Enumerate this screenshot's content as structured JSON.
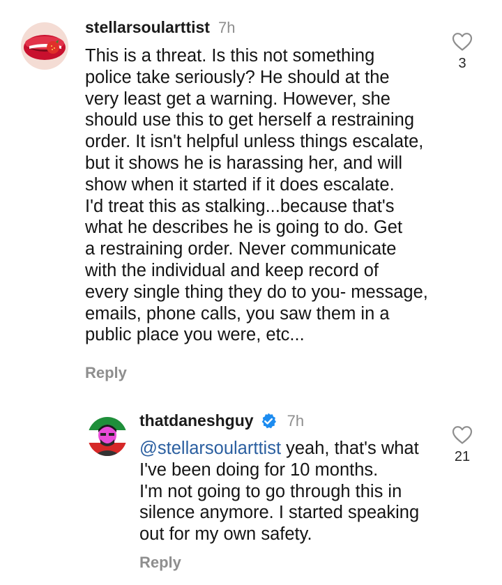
{
  "comments": [
    {
      "username": "stellarsoularttist",
      "time": "7h",
      "text_lines": [
        "This is a threat. Is this not something",
        "police take seriously? He should at the",
        "very least get a warning. However, she",
        "should use this to get herself a restraining",
        "order. It isn't helpful unless things escalate,",
        "but it shows he is harassing her, and will",
        "show when it started if it does escalate.",
        "I'd treat this as stalking...because that's",
        "what he describes he is going to do. Get",
        "a restraining order. Never communicate",
        "with the individual and keep record of",
        "every single thing they do to you- message,",
        "emails, phone calls, you saw them in a",
        "public place you were, etc..."
      ],
      "reply_label": "Reply",
      "like_count": "3",
      "avatar_icon": "lips-strawberry-avatar"
    },
    {
      "username": "thatdaneshguy",
      "verified": true,
      "time": "7h",
      "mention": "@stellarsoularttist",
      "text_lines": [
        " yeah, that's what",
        "I've been doing for 10 months.",
        "I'm not going to go through this in",
        "silence anymore. I started speaking",
        "out for my own safety."
      ],
      "reply_label": "Reply",
      "like_count": "21",
      "avatar_icon": "man-flag-avatar"
    }
  ],
  "colors": {
    "text": "#141414",
    "muted": "#8e8e8e",
    "mention": "#2b5fa0",
    "verified": "#1d8cf0"
  }
}
